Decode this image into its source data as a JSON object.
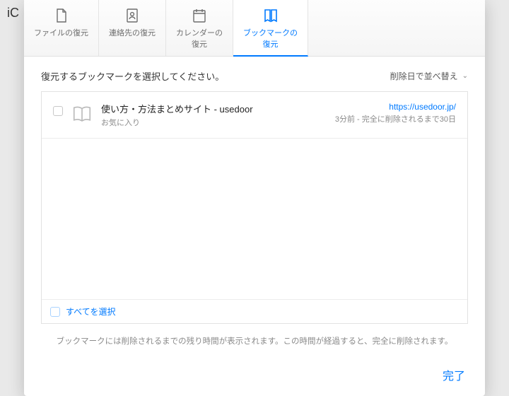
{
  "backdrop": {
    "app": "iC"
  },
  "tabs": [
    {
      "id": "files",
      "label": "ファイルの復元"
    },
    {
      "id": "contacts",
      "label": "連絡先の復元"
    },
    {
      "id": "calendar",
      "label": "カレンダーの\n復元"
    },
    {
      "id": "bookmarks",
      "label": "ブックマークの\n復元"
    }
  ],
  "instruction": "復元するブックマークを選択してください。",
  "sort": {
    "label": "削除日で並べ替え"
  },
  "bookmarks": [
    {
      "title": "使い方・方法まとめサイト - usedoor",
      "folder": "お気に入り",
      "url": "https://usedoor.jp/",
      "meta": "3分前 - 完全に削除されるまで30日"
    }
  ],
  "select_all": "すべてを選択",
  "footnote": "ブックマークには削除されるまでの残り時間が表示されます。この時間が経過すると、完全に削除されます。",
  "done": "完了"
}
